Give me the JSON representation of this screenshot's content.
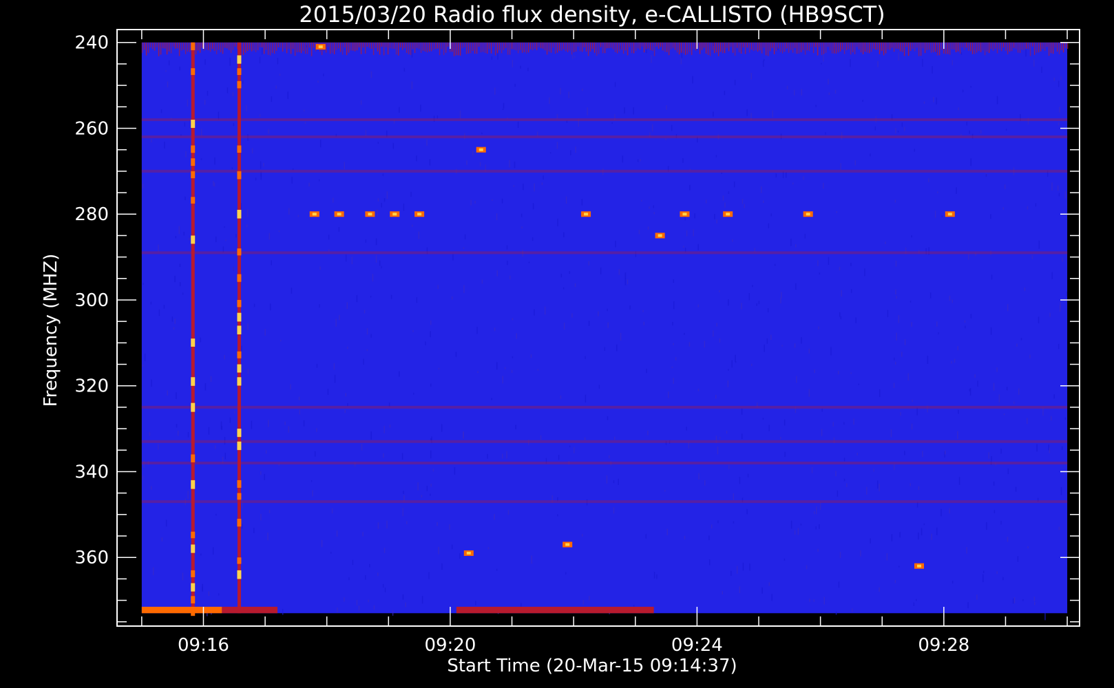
{
  "chart_data": {
    "type": "heatmap",
    "title": "2015/03/20  Radio flux density, e-CALLISTO (HB9SCT)",
    "xlabel": "Start Time (20-Mar-15 09:14:37)",
    "ylabel": "Frequency (MHZ)",
    "x_ticks": [
      "09:16",
      "09:20",
      "09:24",
      "09:28"
    ],
    "x_tick_minutes": [
      16,
      20,
      24,
      28
    ],
    "x_range_minutes": [
      14.6,
      30.2
    ],
    "data_range_minutes": [
      15.0,
      30.0
    ],
    "y_ticks": [
      240,
      260,
      280,
      300,
      320,
      340,
      360
    ],
    "ylim": [
      237,
      376
    ],
    "data_frequency_range": [
      240,
      373
    ],
    "y_reversed": true,
    "colors": {
      "background": "#2323e6",
      "low": "#1a1ad6",
      "mid": "#b81a2e",
      "high": "#ff6a00",
      "peak": "#ffd24a",
      "frame": "#ffffff"
    },
    "features": {
      "vertical_bursts": [
        {
          "time_min": 15.83,
          "freq_from": 240,
          "freq_to": 373
        },
        {
          "time_min": 16.58,
          "freq_from": 240,
          "freq_to": 373
        }
      ],
      "horizontal_bands_mhz": [
        258,
        262,
        270,
        289,
        325,
        333,
        338,
        347
      ],
      "hot_spots": [
        {
          "time_min": 17.8,
          "freq": 280
        },
        {
          "time_min": 18.2,
          "freq": 280
        },
        {
          "time_min": 18.7,
          "freq": 280
        },
        {
          "time_min": 19.1,
          "freq": 280
        },
        {
          "time_min": 19.5,
          "freq": 280
        },
        {
          "time_min": 22.2,
          "freq": 280
        },
        {
          "time_min": 23.8,
          "freq": 280
        },
        {
          "time_min": 24.5,
          "freq": 280
        },
        {
          "time_min": 25.8,
          "freq": 280
        },
        {
          "time_min": 28.1,
          "freq": 280
        },
        {
          "time_min": 23.4,
          "freq": 285
        },
        {
          "time_min": 21.9,
          "freq": 357
        },
        {
          "time_min": 20.3,
          "freq": 359
        },
        {
          "time_min": 27.6,
          "freq": 362
        },
        {
          "time_min": 17.9,
          "freq": 241
        },
        {
          "time_min": 20.5,
          "freq": 265
        }
      ]
    }
  }
}
